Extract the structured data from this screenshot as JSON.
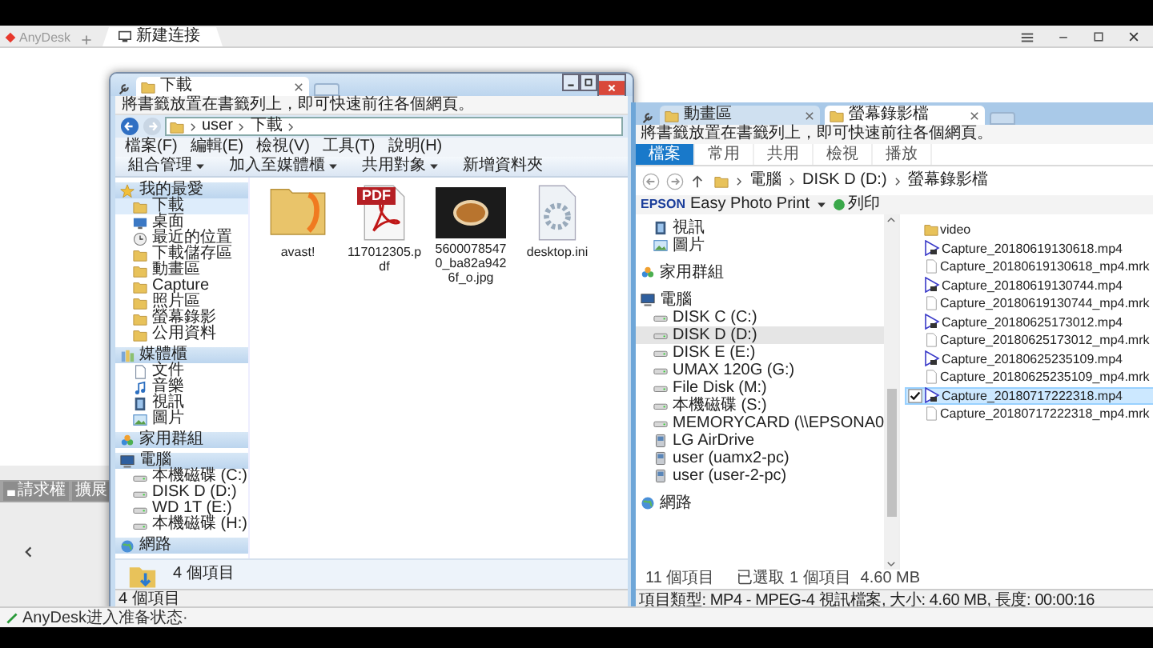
{
  "anydesk": {
    "app_tab": "AnyDesk",
    "session_tab": "新建连接"
  },
  "side_panel": {
    "buttons": [
      "請求權",
      "擴展"
    ]
  },
  "downloads_window": {
    "tab": "下載",
    "bookmark_hint": "將書籤放置在書籤列上，即可快速前往各個網頁。",
    "path": [
      "user",
      "下載"
    ],
    "menu": [
      "檔案(F)",
      "編輯(E)",
      "檢視(V)",
      "工具(T)",
      "說明(H)"
    ],
    "toolbar": [
      {
        "label": "組合管理",
        "dropdown": true
      },
      {
        "label": "加入至媒體櫃",
        "dropdown": true
      },
      {
        "label": "共用對象",
        "dropdown": true
      },
      {
        "label": "新增資料夾",
        "dropdown": false
      }
    ],
    "sidebar": [
      {
        "label": "我的最愛",
        "kind": "star",
        "selected": false,
        "children": [
          {
            "label": "下載",
            "kind": "folder",
            "selected": true
          },
          {
            "label": "桌面",
            "kind": "desktop",
            "selected": false
          },
          {
            "label": "最近的位置",
            "kind": "recent",
            "selected": false
          },
          {
            "label": "下載儲存區",
            "kind": "folder",
            "selected": false
          },
          {
            "label": "動畫區",
            "kind": "folder",
            "selected": false
          },
          {
            "label": "Capture",
            "kind": "folder",
            "selected": false
          },
          {
            "label": "照片區",
            "kind": "folder",
            "selected": false
          },
          {
            "label": "螢幕錄影",
            "kind": "folder",
            "selected": false
          },
          {
            "label": "公用資料",
            "kind": "folder",
            "selected": false
          }
        ]
      },
      {
        "label": "媒體櫃",
        "kind": "library",
        "selected": false,
        "children": [
          {
            "label": "文件",
            "kind": "doc",
            "selected": false
          },
          {
            "label": "音樂",
            "kind": "music",
            "selected": false
          },
          {
            "label": "視訊",
            "kind": "video",
            "selected": false
          },
          {
            "label": "圖片",
            "kind": "picture",
            "selected": false
          }
        ]
      },
      {
        "label": "家用群組",
        "kind": "homegroup",
        "selected": false
      },
      {
        "label": "電腦",
        "kind": "computer",
        "selected": false,
        "children": [
          {
            "label": "本機磁碟 (C:)",
            "kind": "drive",
            "selected": false
          },
          {
            "label": "DISK D (D:)",
            "kind": "drive",
            "selected": false
          },
          {
            "label": "WD 1T (E:)",
            "kind": "drive",
            "selected": false
          },
          {
            "label": "本機磁碟 (H:)",
            "kind": "drive",
            "selected": false
          }
        ]
      },
      {
        "label": "網路",
        "kind": "network",
        "selected": false
      }
    ],
    "files": [
      {
        "name": "avast!",
        "kind": "folder"
      },
      {
        "name": "117012305.pdf",
        "kind": "pdf",
        "badge": "PDF"
      },
      {
        "name": "56000785470_ba82a9426f_o.jpg",
        "kind": "photo"
      },
      {
        "name": "desktop.ini",
        "kind": "settings"
      }
    ],
    "details": "4 個項目",
    "status": "4 個項目"
  },
  "recordings_window": {
    "tabs": [
      {
        "label": "動畫區",
        "selected": false
      },
      {
        "label": "螢幕錄影檔",
        "selected": true
      }
    ],
    "bookmark_hint": "將書籤放置在書籤列上，即可快速前往各個網頁。",
    "ribbon": [
      {
        "label": "檔案",
        "selected": true
      },
      {
        "label": "常用",
        "selected": false
      },
      {
        "label": "共用",
        "selected": false
      },
      {
        "label": "檢視",
        "selected": false
      },
      {
        "label": "播放",
        "selected": false
      }
    ],
    "path": [
      "電腦",
      "DISK D (D:)",
      "螢幕錄影檔"
    ],
    "epson": {
      "brand": "EPSON",
      "app": "Easy Photo Print",
      "print": "列印"
    },
    "sidebar": [
      {
        "children": [
          {
            "label": "視訊",
            "kind": "video",
            "selected": false
          },
          {
            "label": "圖片",
            "kind": "picture",
            "selected": false
          }
        ]
      },
      {
        "label": "家用群組",
        "kind": "homegroup",
        "selected": false
      },
      {
        "label": "電腦",
        "kind": "computer",
        "selected": false,
        "children": [
          {
            "label": "DISK C (C:)",
            "kind": "drive",
            "selected": false
          },
          {
            "label": "DISK D (D:)",
            "kind": "drive",
            "selected": true
          },
          {
            "label": "DISK E (E:)",
            "kind": "drive",
            "selected": false
          },
          {
            "label": "UMAX 120G (G:)",
            "kind": "drive",
            "selected": false
          },
          {
            "label": "File Disk (M:)",
            "kind": "drive",
            "selected": false
          },
          {
            "label": "本機磁碟 (S:)",
            "kind": "drive",
            "selected": false
          },
          {
            "label": "MEMORYCARD (\\\\EPSONA0",
            "kind": "drive",
            "selected": false
          },
          {
            "label": "LG AirDrive",
            "kind": "device",
            "selected": false
          },
          {
            "label": "user (uamx2-pc)",
            "kind": "device",
            "selected": false
          },
          {
            "label": "user (user-2-pc)",
            "kind": "device",
            "selected": false
          }
        ]
      },
      {
        "label": "網路",
        "kind": "network",
        "selected": false
      }
    ],
    "files": [
      {
        "name": "video",
        "kind": "folder",
        "selected": false,
        "checked": false
      },
      {
        "name": "Capture_20180619130618.mp4",
        "kind": "video",
        "selected": false,
        "checked": false
      },
      {
        "name": "Capture_20180619130618_mp4.mrk",
        "kind": "file",
        "selected": false,
        "checked": false
      },
      {
        "name": "Capture_20180619130744.mp4",
        "kind": "video",
        "selected": false,
        "checked": false
      },
      {
        "name": "Capture_20180619130744_mp4.mrk",
        "kind": "file",
        "selected": false,
        "checked": false
      },
      {
        "name": "Capture_20180625173012.mp4",
        "kind": "video",
        "selected": false,
        "checked": false
      },
      {
        "name": "Capture_20180625173012_mp4.mrk",
        "kind": "file",
        "selected": false,
        "checked": false
      },
      {
        "name": "Capture_20180625235109.mp4",
        "kind": "video",
        "selected": false,
        "checked": false
      },
      {
        "name": "Capture_20180625235109_mp4.mrk",
        "kind": "file",
        "selected": false,
        "checked": false
      },
      {
        "name": "Capture_20180717222318.mp4",
        "kind": "video",
        "selected": true,
        "checked": true
      },
      {
        "name": "Capture_20180717222318_mp4.mrk",
        "kind": "file",
        "selected": false,
        "checked": false
      }
    ],
    "item_count": "11 個項目",
    "selection": "已選取 1 個項目",
    "selection_size": "4.60 MB",
    "details": "項目類型: MP4 - MPEG-4 視訊檔案, 大小: 4.60 MB, 長度: 00:00:16"
  },
  "status": "AnyDesk进入准备状态·"
}
